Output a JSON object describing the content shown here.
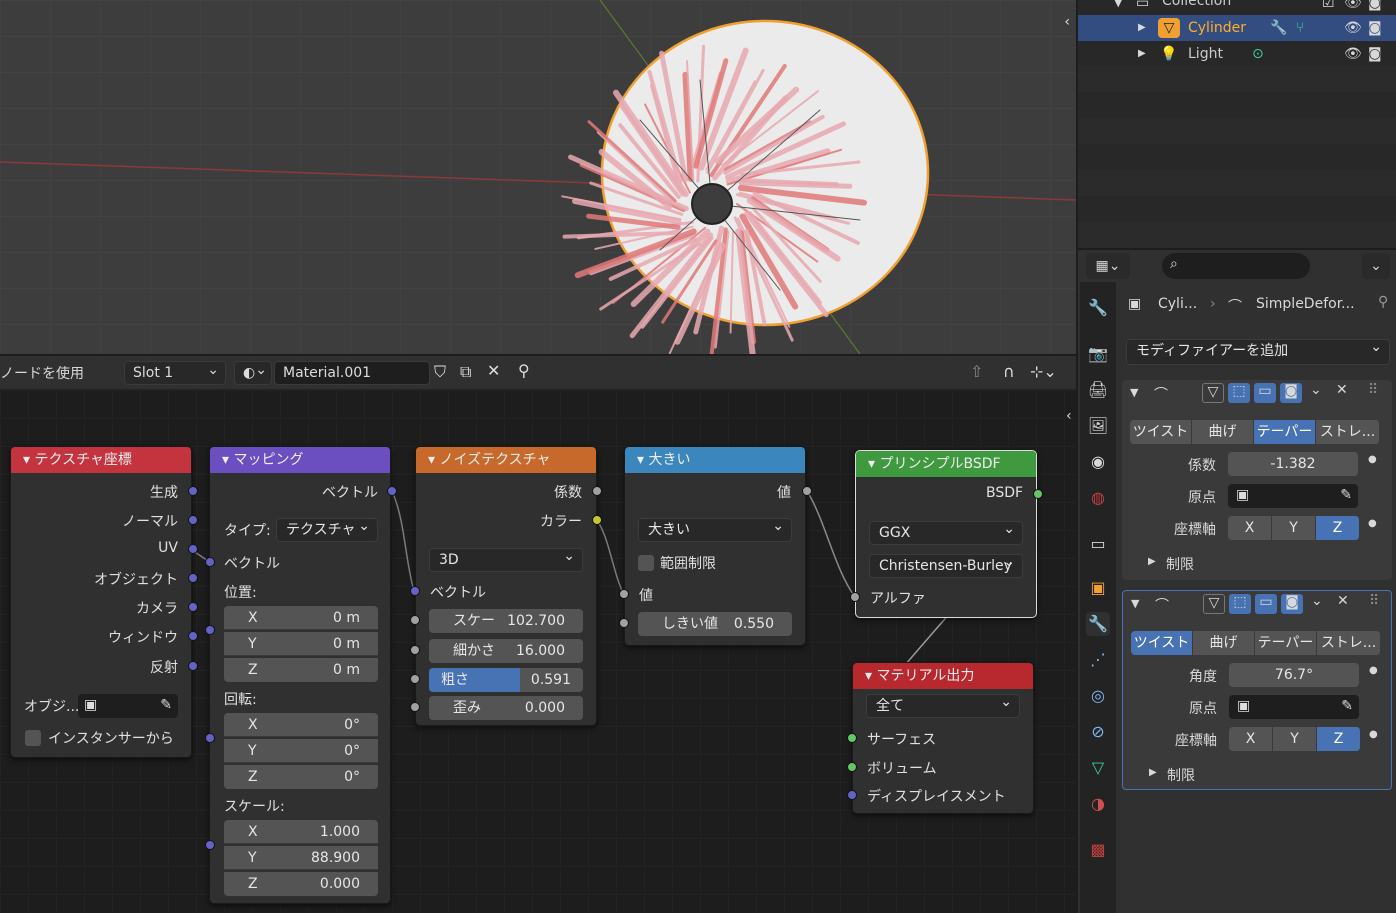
{
  "outliner": {
    "collection_label": "Collection",
    "items": [
      {
        "label": "Cylinder"
      },
      {
        "label": "Light"
      }
    ]
  },
  "node_header": {
    "use_nodes": "ノードを使用",
    "slot": "Slot 1",
    "material": "Material.001"
  },
  "nodes": {
    "texcoord": {
      "title": "テクスチャ座標",
      "outputs": [
        "生成",
        "ノーマル",
        "UV",
        "オブジェクト",
        "カメラ",
        "ウィンドウ",
        "反射"
      ],
      "object_label": "オブジ...",
      "instancer_label": "インスタンサーから"
    },
    "mapping": {
      "title": "マッピング",
      "out_vector": "ベクトル",
      "type_label": "タイプ:",
      "type_value": "テクスチャ",
      "in_vector": "ベクトル",
      "location_label": "位置:",
      "rotation_label": "回転:",
      "scale_label": "スケール:",
      "location": [
        {
          "axis": "X",
          "value": "0 m"
        },
        {
          "axis": "Y",
          "value": "0 m"
        },
        {
          "axis": "Z",
          "value": "0 m"
        }
      ],
      "rotation": [
        {
          "axis": "X",
          "value": "0°"
        },
        {
          "axis": "Y",
          "value": "0°"
        },
        {
          "axis": "Z",
          "value": "0°"
        }
      ],
      "scale": [
        {
          "axis": "X",
          "value": "1.000"
        },
        {
          "axis": "Y",
          "value": "88.900"
        },
        {
          "axis": "Z",
          "value": "0.000"
        }
      ]
    },
    "noise": {
      "title": "ノイズテクスチャ",
      "out_fac": "係数",
      "out_color": "カラー",
      "dim": "3D",
      "in_vector": "ベクトル",
      "scale": {
        "label": "スケー",
        "value": "102.700"
      },
      "detail": {
        "label": "細かさ",
        "value": "16.000"
      },
      "roughness": {
        "label": "粗さ",
        "value": "0.591",
        "fill": 0.591
      },
      "distortion": {
        "label": "歪み",
        "value": "0.000"
      }
    },
    "math": {
      "title": "大きい",
      "out_value": "値",
      "op": "大きい",
      "clamp": "範囲制限",
      "in_value": "値",
      "threshold": {
        "label": "しきい値",
        "value": "0.550"
      }
    },
    "bsdf": {
      "title": "プリンシプルBSDF",
      "out": "BSDF",
      "distribution": "GGX",
      "subsurface": "Christensen-Burley",
      "alpha": "アルファ"
    },
    "output": {
      "title": "マテリアル出力",
      "target": "全て",
      "surface": "サーフェス",
      "volume": "ボリューム",
      "displacement": "ディスプレイスメント"
    }
  },
  "properties": {
    "breadcrumb_obj": "Cyli...",
    "breadcrumb_mod": "SimpleDefor...",
    "add_modifier": "モディファイアーを追加",
    "modifiers": [
      {
        "tabs": [
          "ツイスト",
          "曲げ",
          "テーパー",
          "ストレ..."
        ],
        "active_tab": 2,
        "param_label": "係数",
        "param_value": "-1.382",
        "origin_label": "原点",
        "axis_label": "座標軸",
        "axes": [
          "X",
          "Y",
          "Z"
        ],
        "limits_label": "制限"
      },
      {
        "tabs": [
          "ツイスト",
          "曲げ",
          "テーパー",
          "ストレ..."
        ],
        "active_tab": 0,
        "param_label": "角度",
        "param_value": "76.7°",
        "origin_label": "原点",
        "axis_label": "座標軸",
        "axes": [
          "X",
          "Y",
          "Z"
        ],
        "limits_label": "制限"
      }
    ]
  },
  "colors": {
    "texcoord_header": "#c4343f",
    "mapping_header": "#6b4fc1",
    "noise_header": "#c7692a",
    "math_header": "#3b87bd",
    "bsdf_header": "#3f9a3f",
    "output_header": "#b8282f",
    "selected_accent": "#4772b3"
  }
}
